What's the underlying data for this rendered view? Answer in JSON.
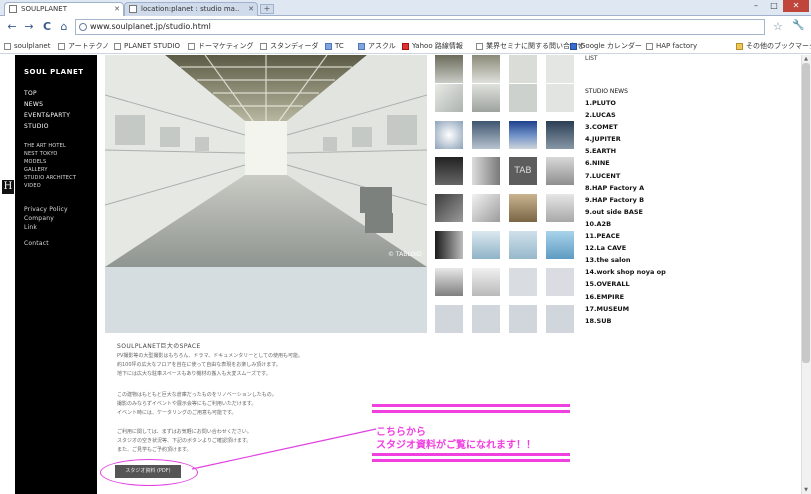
{
  "browser": {
    "tabs": [
      {
        "title": "SOULPLANET",
        "active": true
      },
      {
        "title": "location:planet : studio ma..",
        "active": false
      }
    ],
    "new_tab": "+",
    "win_min": "–",
    "win_max": "□",
    "win_close": "✕",
    "back": "←",
    "forward": "→",
    "reload": "C",
    "home": "⌂",
    "url": "www.soulplanet.jp/studio.html",
    "star": "☆",
    "wrench": "🔧",
    "bookmarks": [
      "soulplanet",
      "アートテクノ",
      "PLANET STUDIO",
      "ドーマケティング",
      "スタンディーダ",
      "TC",
      "アスクル",
      "Yahoo 路線情報",
      "業界セミナに関する問い合わせ",
      "Google カレンダー",
      "HAP factory",
      "その他のブックマーク"
    ]
  },
  "site": {
    "logo": "SOUL PLANET",
    "nav_main": [
      "TOP",
      "NEWS",
      "EVENT&PARTY",
      "STUDIO"
    ],
    "nav_sub": [
      "THE ART HOTEL",
      "NEST TOKYO",
      "MODELS",
      "GALLERY",
      "STUDIO ARCHITECT",
      "VIDEO"
    ],
    "nav_footer": [
      "Privacy Policy",
      "Company",
      "Link"
    ],
    "nav_contact": "Contact",
    "h_badge": "H",
    "photo_credit": "© TABLOID",
    "caption": "SOULPLANET巨大のSPACE",
    "para1": [
      "PV撮影等の大型撮影はもちろん、ドラマ、ドキュメンタリーとしての使用も可能。",
      "約100坪の広大なフロアを自在に使って自由な表現をお楽しみ頂けます。",
      "地下には広大な駐車スペースもあり機材の搬入も大変スムーズです。"
    ],
    "para2": [
      "この建物はもともと巨大な倉庫だったものをリノベーションしたもの。",
      "撮影のみならずイベントや展示会等にもご利用いただけます。",
      "イベント時には、ケータリングのご用意も可能です。"
    ],
    "para3": [
      "ご利用に関しては、まずはお気軽にお問い合わせください。",
      "スタジオの空き状況等、下記のボタンよりご確認頂けます。",
      "また、ご見学もご予約頂けます。"
    ],
    "studio_button": "スタジオ資料 (PDF)",
    "news_cut_top": "LIST",
    "news_title": "STUDIO NEWS",
    "news_items": [
      "1.PLUTO",
      "2.LUCAS",
      "3.COMET",
      "4.JUPITER",
      "5.EARTH",
      "6.NINE",
      "7.LUCENT",
      "8.HAP Factory A",
      "9.HAP Factory B",
      "9.out side BASE",
      "10.A2B",
      "11.PEACE",
      "12.La CAVE",
      "13.the salon",
      "14.work shop noya op",
      "15.OVERALL",
      "16.EMPIRE",
      "17.MUSEUM",
      "18.SUB"
    ]
  },
  "annotation": {
    "line1": "こちらから",
    "line2": "スタジオ資料がご覧になれます！！"
  },
  "colors": {
    "annotation": "#f040e0",
    "sidebar": "#000000"
  }
}
